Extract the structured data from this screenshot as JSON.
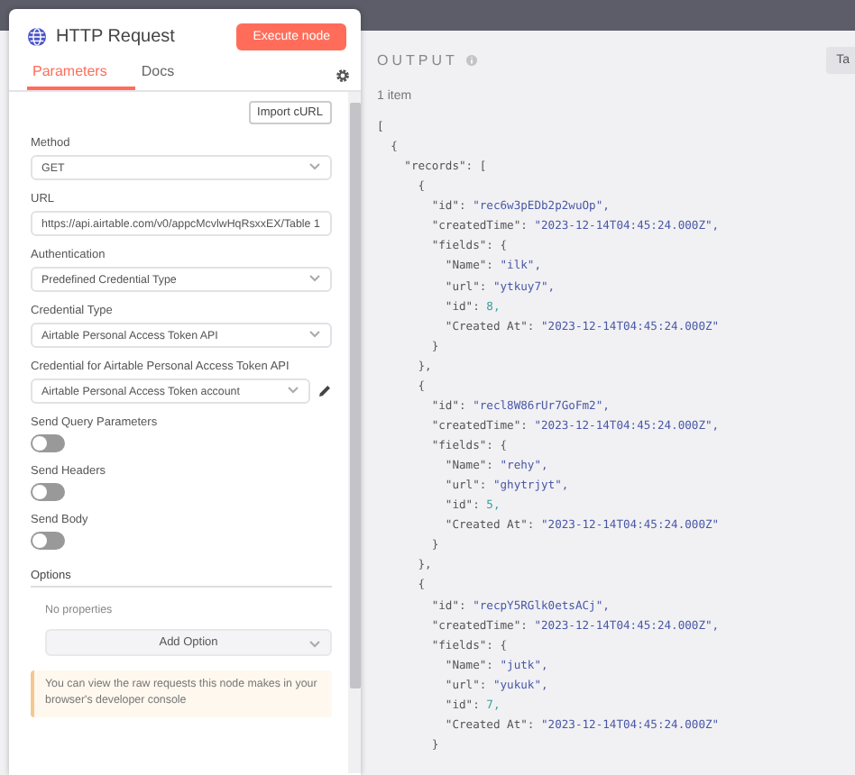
{
  "node": {
    "title": "HTTP Request",
    "execute_button": "Execute node"
  },
  "tabs": [
    {
      "label": "Parameters",
      "selected": true
    },
    {
      "label": "Docs",
      "selected": false
    }
  ],
  "import_button": "Import cURL",
  "fields": [
    {
      "kind": "select",
      "label": "Method",
      "value": "GET"
    },
    {
      "kind": "text",
      "label": "URL",
      "value": "https://api.airtable.com/v0/appcMcvlwHqRsxxEX/Table 1"
    },
    {
      "kind": "select",
      "label": "Authentication",
      "value": "Predefined Credential Type"
    },
    {
      "kind": "select",
      "label": "Credential Type",
      "value": "Airtable Personal Access Token API"
    },
    {
      "kind": "credential",
      "label": "Credential for Airtable Personal Access Token API",
      "value": "Airtable Personal Access Token account"
    },
    {
      "kind": "toggle",
      "label": "Send Query Parameters",
      "on": false
    },
    {
      "kind": "toggle",
      "label": "Send Headers",
      "on": false
    },
    {
      "kind": "toggle",
      "label": "Send Body",
      "on": false
    }
  ],
  "options": {
    "title": "Options",
    "empty_text": "No properties",
    "add_button": "Add Option"
  },
  "notice": "You can view the raw requests this node makes in your browser's developer console",
  "output": {
    "title": "OUTPUT",
    "tab_button": "Ta",
    "count": "1 item",
    "lines": [
      {
        "text": "["
      },
      {
        "text": "  {"
      },
      {
        "text": "    \"records\": ["
      },
      {
        "text": "      {"
      },
      {
        "text": "        \"id\": ",
        "value": "\"rec6w3pEDb2p2wuOp\",",
        "kind": "string"
      },
      {
        "text": "        \"createdTime\": ",
        "value": "\"2023-12-14T04:45:24.000Z\",",
        "kind": "string"
      },
      {
        "text": "        \"fields\": {"
      },
      {
        "text": "          \"Name\": ",
        "value": "\"ilk\",",
        "kind": "string"
      },
      {
        "text": "          \"url\": ",
        "value": "\"ytkuy7\",",
        "kind": "string"
      },
      {
        "text": "          \"id\": ",
        "value": "8,",
        "kind": "number"
      },
      {
        "text": "          \"Created At\": ",
        "value": "\"2023-12-14T04:45:24.000Z\"",
        "kind": "string"
      },
      {
        "text": "        }"
      },
      {
        "text": "      },"
      },
      {
        "text": "      {"
      },
      {
        "text": "        \"id\": ",
        "value": "\"recl8W86rUr7GoFm2\",",
        "kind": "string"
      },
      {
        "text": "        \"createdTime\": ",
        "value": "\"2023-12-14T04:45:24.000Z\",",
        "kind": "string"
      },
      {
        "text": "        \"fields\": {"
      },
      {
        "text": "          \"Name\": ",
        "value": "\"rehy\",",
        "kind": "string"
      },
      {
        "text": "          \"url\": ",
        "value": "\"ghytrjyt\",",
        "kind": "string"
      },
      {
        "text": "          \"id\": ",
        "value": "5,",
        "kind": "number"
      },
      {
        "text": "          \"Created At\": ",
        "value": "\"2023-12-14T04:45:24.000Z\"",
        "kind": "string"
      },
      {
        "text": "        }"
      },
      {
        "text": "      },"
      },
      {
        "text": "      {"
      },
      {
        "text": "        \"id\": ",
        "value": "\"recpY5RGlk0etsACj\",",
        "kind": "string"
      },
      {
        "text": "        \"createdTime\": ",
        "value": "\"2023-12-14T04:45:24.000Z\",",
        "kind": "string"
      },
      {
        "text": "        \"fields\": {"
      },
      {
        "text": "          \"Name\": ",
        "value": "\"jutk\",",
        "kind": "string"
      },
      {
        "text": "          \"url\": ",
        "value": "\"yukuk\",",
        "kind": "string"
      },
      {
        "text": "          \"id\": ",
        "value": "7,",
        "kind": "number"
      },
      {
        "text": "          \"Created At\": ",
        "value": "\"2023-12-14T04:45:24.000Z\"",
        "kind": "string"
      },
      {
        "text": "        }"
      }
    ]
  }
}
